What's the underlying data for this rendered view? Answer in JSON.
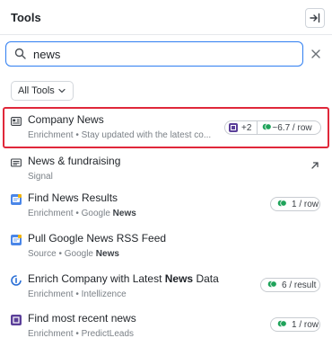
{
  "header": {
    "title": "Tools"
  },
  "search": {
    "value": "news",
    "placeholder": ""
  },
  "filter": {
    "label": "All Tools"
  },
  "items": [
    {
      "name": "Company News",
      "sub_text": "Enrichment • Stay updated with the latest co...",
      "icon": "card-icon",
      "badge_extra": "+2",
      "cost": "~6.7 / row",
      "highlighted": true
    },
    {
      "name": "News & fundraising",
      "sub_text": "Signal",
      "icon": "newspaper-icon",
      "action": "open-arrow-icon"
    },
    {
      "name": "Find News Results",
      "sub_pre": "Enrichment • Google ",
      "sub_bold": "News",
      "icon": "google-search-icon",
      "cost": "1 / row"
    },
    {
      "name": "Pull Google News RSS Feed",
      "sub_pre": "Source • Google ",
      "sub_bold": "News",
      "icon": "google-search-icon"
    },
    {
      "name_pre": "Enrich Company with Latest ",
      "name_bold": "News",
      "name_post": " Data",
      "sub_text": "Enrichment • Intellizence",
      "icon": "intellizence-icon",
      "cost": "6 / result"
    },
    {
      "name": "Find most recent news",
      "sub_text": "Enrichment • PredictLeads",
      "icon": "predictleads-icon",
      "cost": "1 / row"
    }
  ],
  "colors": {
    "accent": "#2f7ef1",
    "highlight": "#e0283a",
    "credit_green": "#1fa35a",
    "brand_purple": "#5b3f99"
  }
}
